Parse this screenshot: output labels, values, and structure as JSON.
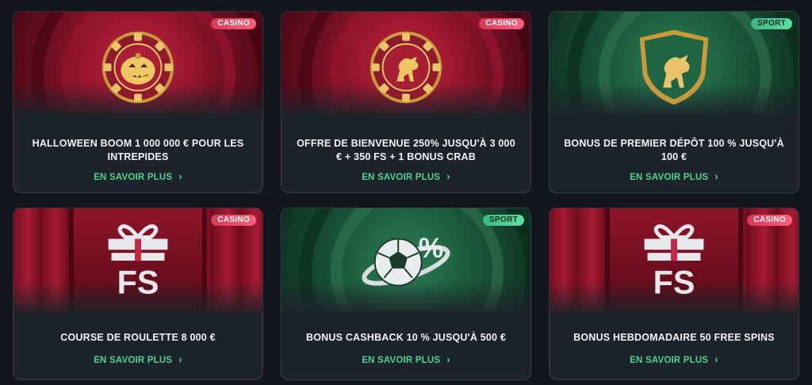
{
  "cards": [
    {
      "tag": "CASINO",
      "title": "HALLOWEEN BOOM 1 000 000 € POUR LES INTREPIDES",
      "cta": "EN SAVOIR PLUS",
      "icon": "pumpkin-chip-icon"
    },
    {
      "tag": "CASINO",
      "title": "OFFRE DE BIENVENUE 250% JUSQU'À 3 000 € + 350 FS + 1 BONUS CRAB",
      "cta": "EN SAVOIR PLUS",
      "icon": "lion-chip-icon"
    },
    {
      "tag": "SPORT",
      "title": "BONUS DE PREMIER DÉPÔT 100 % JUSQU'À 100 €",
      "cta": "EN SAVOIR PLUS",
      "icon": "lion-shield-icon"
    },
    {
      "tag": "CASINO",
      "title": "COURSE DE ROULETTE 8 000 €",
      "cta": "EN SAVOIR PLUS",
      "icon": "fs-gift-icon"
    },
    {
      "tag": "SPORT",
      "title": "BONUS CASHBACK 10 % JUSQU'À 500 €",
      "cta": "EN SAVOIR PLUS",
      "icon": "soccer-percent-icon"
    },
    {
      "tag": "CASINO",
      "title": "BONUS HEBDOMADAIRE 50 FREE SPINS",
      "cta": "EN SAVOIR PLUS",
      "icon": "fs-gift-icon"
    }
  ],
  "chevron_glyph": "›",
  "fs_text": "FS",
  "colors": {
    "casino_badge": "#e0455f",
    "sport_badge": "#48c98f",
    "cta": "#4fd394",
    "card_bg": "#1d232a",
    "page_bg": "#13171d"
  }
}
